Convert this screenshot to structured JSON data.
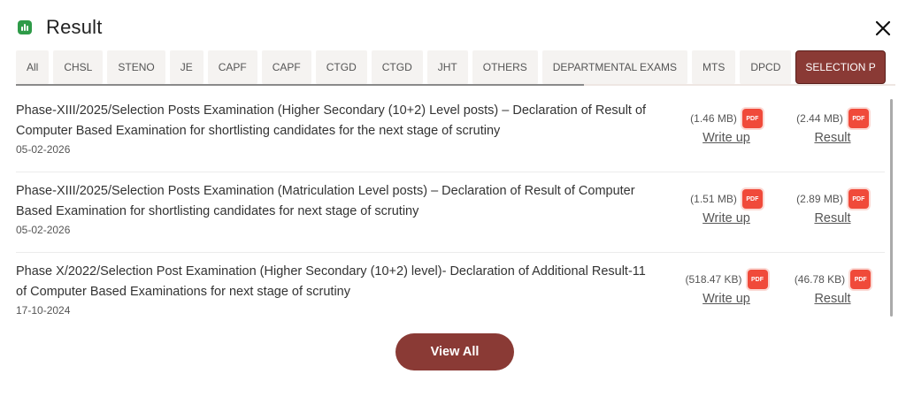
{
  "header": {
    "title": "Result",
    "icon": "bar-chart-icon",
    "icon_color": "#2e9b48"
  },
  "close": {
    "icon": "close-icon"
  },
  "tabs": [
    {
      "label": "All"
    },
    {
      "label": "CHSL"
    },
    {
      "label": "STENO"
    },
    {
      "label": "JE"
    },
    {
      "label": "CAPF"
    },
    {
      "label": "CAPF"
    },
    {
      "label": "CTGD"
    },
    {
      "label": "CTGD"
    },
    {
      "label": "JHT"
    },
    {
      "label": "OTHERS"
    },
    {
      "label": "DEPARTMENTAL EXAMS"
    },
    {
      "label": "MTS"
    },
    {
      "label": "DPCD"
    },
    {
      "label": "SELECTION P"
    }
  ],
  "active_tab": "SELECTION P",
  "results": [
    {
      "title": "Phase-XIII/2025/Selection Posts Examination (Higher Secondary (10+2) Level posts) – Declaration of Result of Computer Based Examination for shortlisting candidates for the next stage of scrutiny",
      "date": "05-02-2026",
      "writeup_size": "(1.46 MB)",
      "writeup_label": "Write up",
      "result_size": "(2.44 MB)",
      "result_label": "Result"
    },
    {
      "title": "Phase-XIII/2025/Selection Posts Examination (Matriculation Level posts) – Declaration of Result of Computer Based Examination for shortlisting candidates for next stage of scrutiny",
      "date": "05-02-2026",
      "writeup_size": "(1.51 MB)",
      "writeup_label": "Write up",
      "result_size": "(2.89 MB)",
      "result_label": "Result"
    },
    {
      "title": "Phase X/2022/Selection Post Examination (Higher Secondary (10+2) level)- Declaration of Additional Result-11 of Computer Based Examinations for next stage of scrutiny",
      "date": "17-10-2024",
      "writeup_size": "(518.47 KB)",
      "writeup_label": "Write up",
      "result_size": "(46.78 KB)",
      "result_label": "Result"
    }
  ],
  "pdf_label": "PDF",
  "view_all_label": "View All",
  "colors": {
    "brand": "#8a3a35",
    "pdf": "#f04a3a",
    "tab_bg": "#f5f3f1"
  }
}
